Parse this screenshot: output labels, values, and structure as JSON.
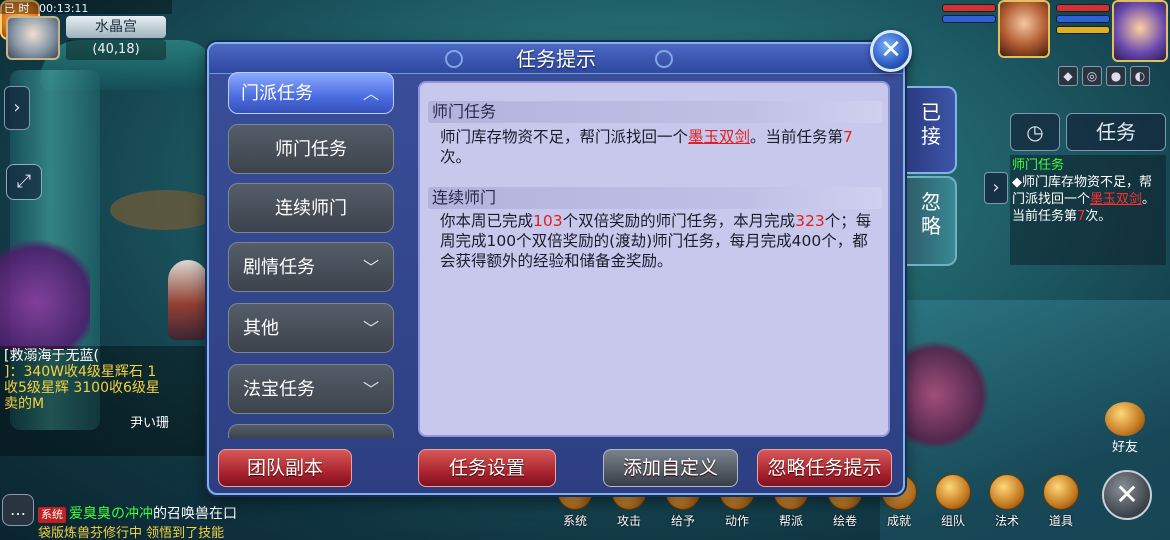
{
  "status_bar": {
    "state": "已 时",
    "time": "00:13:11"
  },
  "map": {
    "name": "水晶宫",
    "coords": "(40,18)"
  },
  "dialog": {
    "title": "任务提示",
    "categories": {
      "active": "门派任务",
      "sub1": "师门任务",
      "sub2": "连续师门",
      "group1": "剧情任务",
      "group2": "其他",
      "group3": "法宝任务"
    },
    "section1": {
      "title": "师门任务",
      "text_a": "师门库存物资不足，帮门派找回一个",
      "item": "墨玉双剑",
      "text_b": "。当前任务第",
      "count": "7",
      "text_c": "次。"
    },
    "section2": {
      "title": "连续师门",
      "t1": "你本周已完成",
      "n1": "103",
      "t2": "个双倍奖励的师门任务，本月完成",
      "n2": "323",
      "t3": "个；每周完成100个双倍奖励的(渡劫)师门任务，每月完成400个，都会获得额外的经验和储备金奖励。"
    },
    "side_tabs": {
      "accepted": "已接",
      "ignored": "忽略"
    },
    "buttons": {
      "team_dungeon": "团队副本",
      "task_settings": "任务设置",
      "add_custom": "添加自定义",
      "ignore_hint": "忽略任务提示"
    }
  },
  "tracker": {
    "tab_title": "任务",
    "head": "师门任务",
    "text_a": "◆师门库存物资不足，帮门派找回一个",
    "item": "墨玉双剑",
    "text_b": "。当前任务第",
    "count": "7",
    "text_c": "次。"
  },
  "chat": {
    "line1": "[救溺海于无蓝(",
    "line2": "]：340W收4级星辉石  1",
    "line3": "收5级星辉  3100收6级星",
    "line4": "卖的M",
    "line5": "尹い珊"
  },
  "system_msg": {
    "tag": "系统",
    "name": "爱臭臭の冲冲",
    "text": "的召唤兽在口",
    "line2": "袋版炼兽芬修行中  领悟到了技能"
  },
  "bottom_menu": [
    "系统",
    "攻击",
    "给予",
    "动作",
    "帮派",
    "绘卷",
    "成就",
    "组队",
    "法术",
    "道具"
  ],
  "friend_label": "好友",
  "icons": {
    "close": "close-icon",
    "chevron_up": "chevron-up-icon",
    "chevron_down": "chevron-down-icon",
    "timer": "timer-icon"
  },
  "colors": {
    "accent_red": "#e02020",
    "tracker_green": "#3cff3c",
    "dialog_blue": "#2d3f82"
  }
}
